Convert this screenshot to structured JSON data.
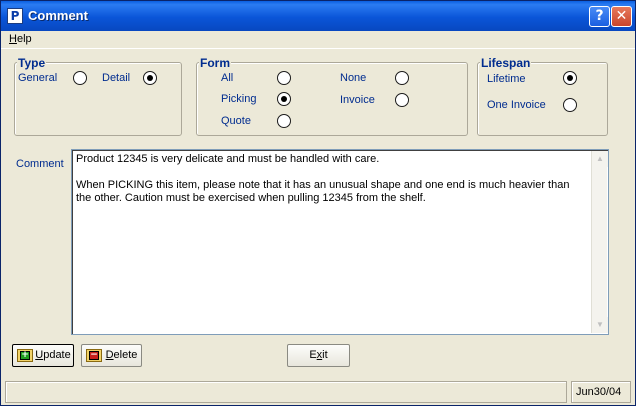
{
  "window": {
    "title": "Comment",
    "help_button": "?",
    "close_button": "✕",
    "app_icon": "P"
  },
  "menu": {
    "help_label": "Help",
    "help_mnemonic": "H",
    "help_rest": "elp"
  },
  "type_group": {
    "title": "Type",
    "options": [
      {
        "label": "General",
        "selected": false
      },
      {
        "label": "Detail",
        "selected": true
      }
    ]
  },
  "form_group": {
    "title": "Form",
    "options": [
      {
        "label": "All",
        "selected": false
      },
      {
        "label": "Picking",
        "selected": true
      },
      {
        "label": "Quote",
        "selected": false
      },
      {
        "label": "None",
        "selected": false
      },
      {
        "label": "Invoice",
        "selected": false
      }
    ]
  },
  "lifespan_group": {
    "title": "Lifespan",
    "options": [
      {
        "label": "Lifetime",
        "selected": true
      },
      {
        "label": "One Invoice",
        "selected": false
      }
    ]
  },
  "comment": {
    "label": "Comment",
    "line1": "Product 12345 is very delicate and must be handled with care.",
    "line2": "When PICKING this item, please note that it has an unusual shape and one end is much heavier than the other. Caution must be exercised when pulling 12345 from the shelf."
  },
  "buttons": {
    "update_mnemonic": "U",
    "update_rest": "pdate",
    "delete_mnemonic": "D",
    "delete_rest": "elete",
    "exit_first": "E",
    "exit_mnemonic": "x",
    "exit_rest": "it"
  },
  "statusbar": {
    "date": "Jun30/04"
  },
  "icons": {
    "add": "+",
    "remove": "−"
  },
  "colors": {
    "label_blue": "#002c8f",
    "title_blue": "#0a55d8",
    "panel_bg": "#ece9d8"
  }
}
